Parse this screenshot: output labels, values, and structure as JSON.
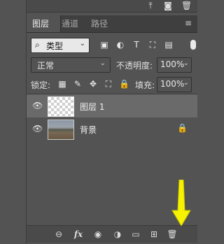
{
  "tabs": [
    {
      "label": "图层"
    },
    {
      "label": "通道"
    },
    {
      "label": "路径"
    }
  ],
  "filter": {
    "label": "类型"
  },
  "blend": {
    "mode": "正常",
    "opacity_label": "不透明度:",
    "opacity_value": "100%"
  },
  "lock": {
    "label": "锁定:",
    "fill_label": "填充:",
    "fill_value": "100%"
  },
  "layers": [
    {
      "name": "图层 1",
      "selected": true
    },
    {
      "name": "背景",
      "locked": true
    }
  ],
  "annotation": {
    "arrow_color": "#f7f300"
  }
}
